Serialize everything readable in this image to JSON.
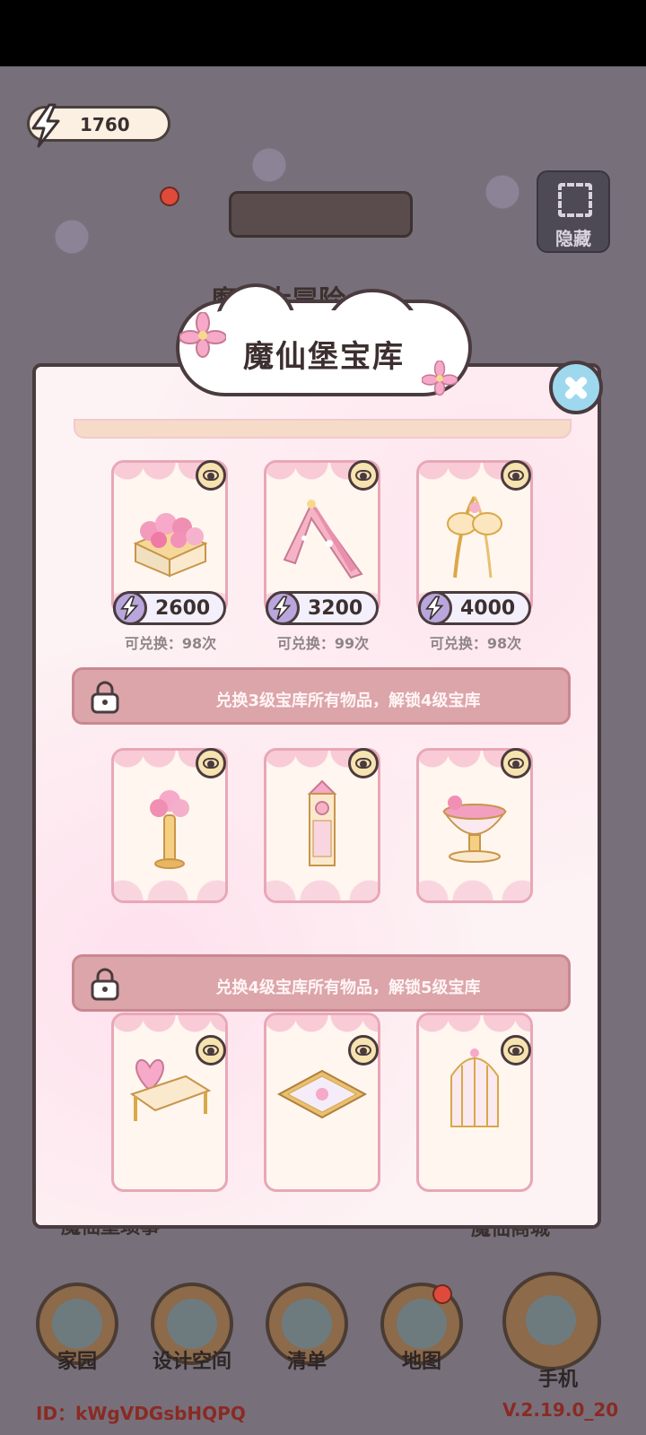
{
  "hud": {
    "energy": "1760",
    "hide_label": "隐藏",
    "bg_title": "魔仙大冒险"
  },
  "modal": {
    "title": "魔仙堡宝库",
    "tier3_items": [
      {
        "name": "flower-planter",
        "price": "2600",
        "note": "可兑换：98次"
      },
      {
        "name": "pink-triangle-frame",
        "price": "3200",
        "note": "可兑换：99次"
      },
      {
        "name": "golden-butterfly-wand",
        "price": "4000",
        "note": "可兑换：98次"
      }
    ],
    "lock4_text": "兑换3级宝库所有物品，解锁4级宝库",
    "lock5_text": "兑换4级宝库所有物品，解锁5级宝库"
  },
  "side_labels": {
    "left": "魔仙堡琐事",
    "right": "魔仙商城"
  },
  "nav": {
    "home": "家园",
    "design": "设计空间",
    "list": "清单",
    "map": "地图",
    "phone": "手机"
  },
  "footer": {
    "id": "ID：kWgVDGsbHQPQ",
    "version": "V.2.19.0_20"
  },
  "colors": {
    "accent_pink": "#e8a7b7",
    "lock_bar": "#dca5aa",
    "close_blue": "#9ed8ef"
  }
}
